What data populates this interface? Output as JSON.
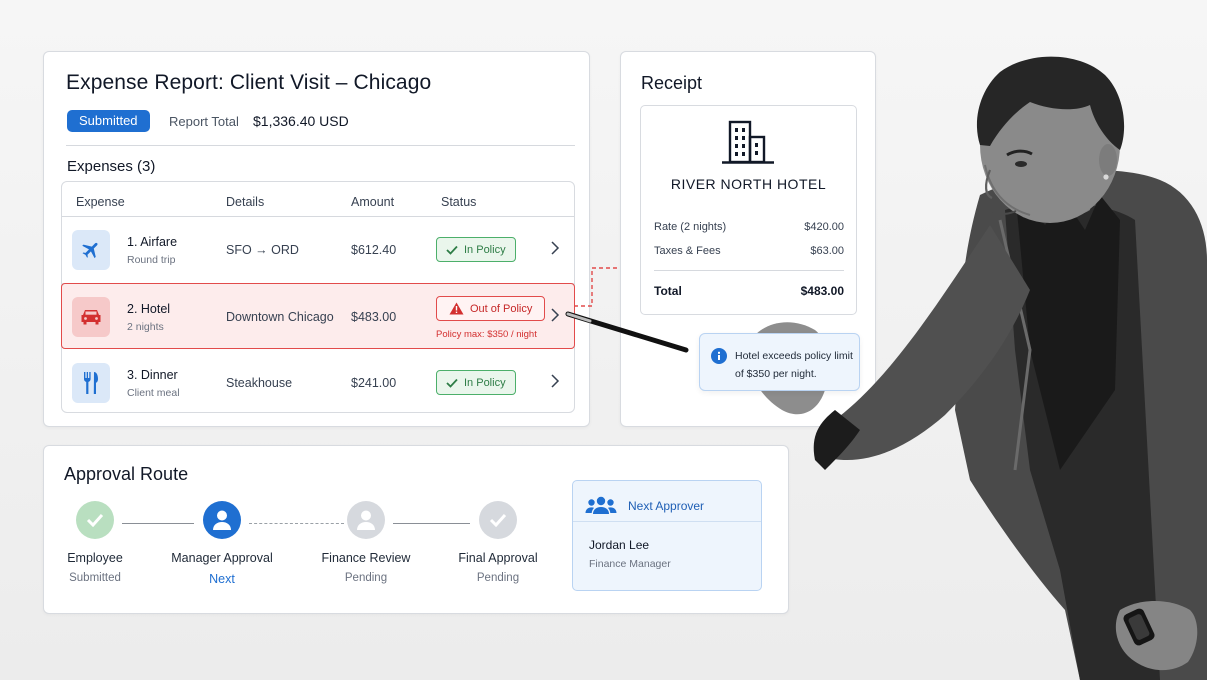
{
  "report": {
    "title": "Expense Report: Client Visit – Chicago",
    "status": "Submitted",
    "total_label": "Report Total",
    "total_value": "$1,336.40 USD",
    "expenses_heading": "Expenses (3)",
    "columns": [
      "Expense",
      "Details",
      "Amount",
      "Status"
    ],
    "items": [
      {
        "name": "1. Airfare",
        "sub": "Round trip",
        "details": "SFO → ORD",
        "amount": "$612.40",
        "status": "In Policy",
        "icon": "airplane-icon"
      },
      {
        "name": "2. Hotel",
        "sub": "2 nights",
        "details": "Downtown Chicago",
        "amount": "$483.00",
        "status": "Out of Policy",
        "note": "Policy max: $350 / night",
        "icon": "car-icon"
      },
      {
        "name": "3. Dinner",
        "sub": "Client meal",
        "details": "Steakhouse",
        "amount": "$241.00",
        "status": "In Policy",
        "icon": "utensils-icon"
      }
    ]
  },
  "receipt": {
    "title": "Receipt",
    "vendor": "RIVER NORTH HOTEL",
    "lines": [
      {
        "label": "Rate (2 nights)",
        "value": "$420.00"
      },
      {
        "label": "Taxes & Fees",
        "value": "$63.00"
      }
    ],
    "total_label": "Total",
    "total_value": "$483.00",
    "tip": "Hotel exceeds policy limit of $350 per night."
  },
  "approval": {
    "title": "Approval Route",
    "steps": [
      {
        "label": "Employee",
        "sub": "Submitted"
      },
      {
        "label": "Manager Approval",
        "sub": "Next"
      },
      {
        "label": "Finance Review",
        "sub": "Pending"
      },
      {
        "label": "Final Approval",
        "sub": "Pending"
      }
    ],
    "next_approver_label": "Next Approver",
    "approver_name": "Jordan Lee",
    "approver_role": "Finance Manager"
  },
  "colors": {
    "accent": "#1f6fd1",
    "success": "#4caf6a",
    "danger": "#e24b4b",
    "flag_bg": "#fdecec",
    "info_bg": "#eef5fd"
  }
}
